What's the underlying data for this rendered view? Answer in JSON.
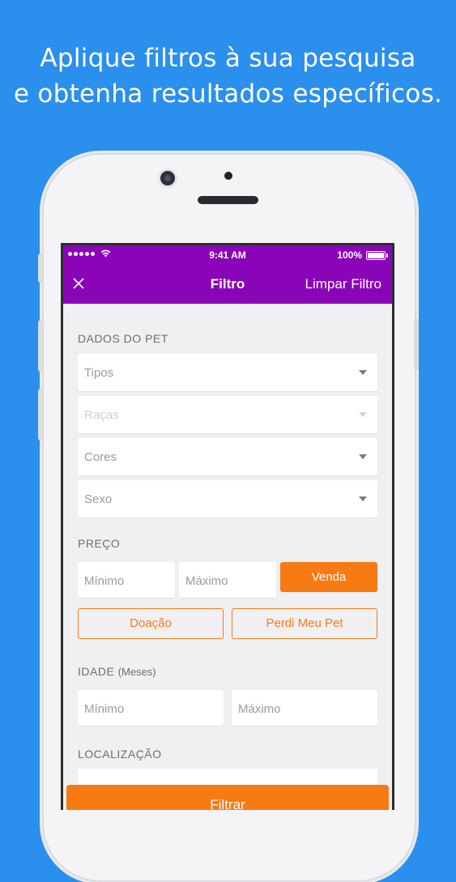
{
  "headline": {
    "line1": "Aplique filtros à sua pesquisa",
    "line2": "e obtenha resultados específicos."
  },
  "status_bar": {
    "time": "9:41 AM",
    "battery": "100%"
  },
  "nav": {
    "close_icon": "close-icon",
    "title": "Filtro",
    "clear_label": "Limpar Filtro"
  },
  "pet_section": {
    "label": "DADOS DO PET",
    "selects": [
      {
        "placeholder": "Tipos",
        "disabled": false
      },
      {
        "placeholder": "Raças",
        "disabled": true
      },
      {
        "placeholder": "Cores",
        "disabled": false
      },
      {
        "placeholder": "Sexo",
        "disabled": false
      }
    ]
  },
  "price_section": {
    "label": "PREÇO",
    "min_placeholder": "Mínimo",
    "max_placeholder": "Máximo",
    "buttons": {
      "venda": "Venda",
      "doacao": "Doação",
      "perdi": "Perdi Meu Pet"
    }
  },
  "age_section": {
    "label": "IDADE",
    "unit": "(Meses)",
    "min_placeholder": "Mínimo",
    "max_placeholder": "Máximo"
  },
  "location_section": {
    "label": "LOCALIZAÇÃO"
  },
  "submit_label": "Filtrar",
  "colors": {
    "background": "#2b8fee",
    "header": "#8b05b8",
    "accent": "#f77b12"
  }
}
